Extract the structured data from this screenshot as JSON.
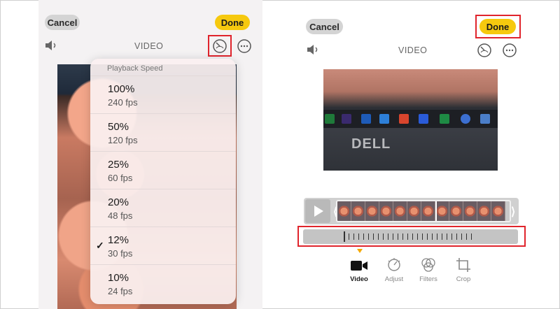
{
  "left": {
    "cancel_label": "Cancel",
    "done_label": "Done",
    "title": "VIDEO",
    "menu": {
      "header": "Playback Speed",
      "items": [
        {
          "speed": "100%",
          "fps": "240 fps"
        },
        {
          "speed": "50%",
          "fps": "120 fps"
        },
        {
          "speed": "25%",
          "fps": "60 fps"
        },
        {
          "speed": "20%",
          "fps": "48 fps"
        },
        {
          "speed": "12%",
          "fps": "30 fps",
          "selected": true
        },
        {
          "speed": "10%",
          "fps": "24 fps"
        }
      ],
      "check_mark": "✓"
    }
  },
  "right": {
    "cancel_label": "Cancel",
    "done_label": "Done",
    "title": "VIDEO",
    "video_brand_text": "DELL",
    "toolbar": [
      {
        "label": "Video",
        "icon": "video-camera-icon",
        "active": true
      },
      {
        "label": "Adjust",
        "icon": "adjust-dial-icon",
        "active": false
      },
      {
        "label": "Filters",
        "icon": "filters-circles-icon",
        "active": false
      },
      {
        "label": "Crop",
        "icon": "crop-icon",
        "active": false
      }
    ]
  },
  "colors": {
    "done_yellow": "#f6c90e",
    "highlight_red": "#e0242c",
    "pointer_orange": "#f5a800"
  }
}
